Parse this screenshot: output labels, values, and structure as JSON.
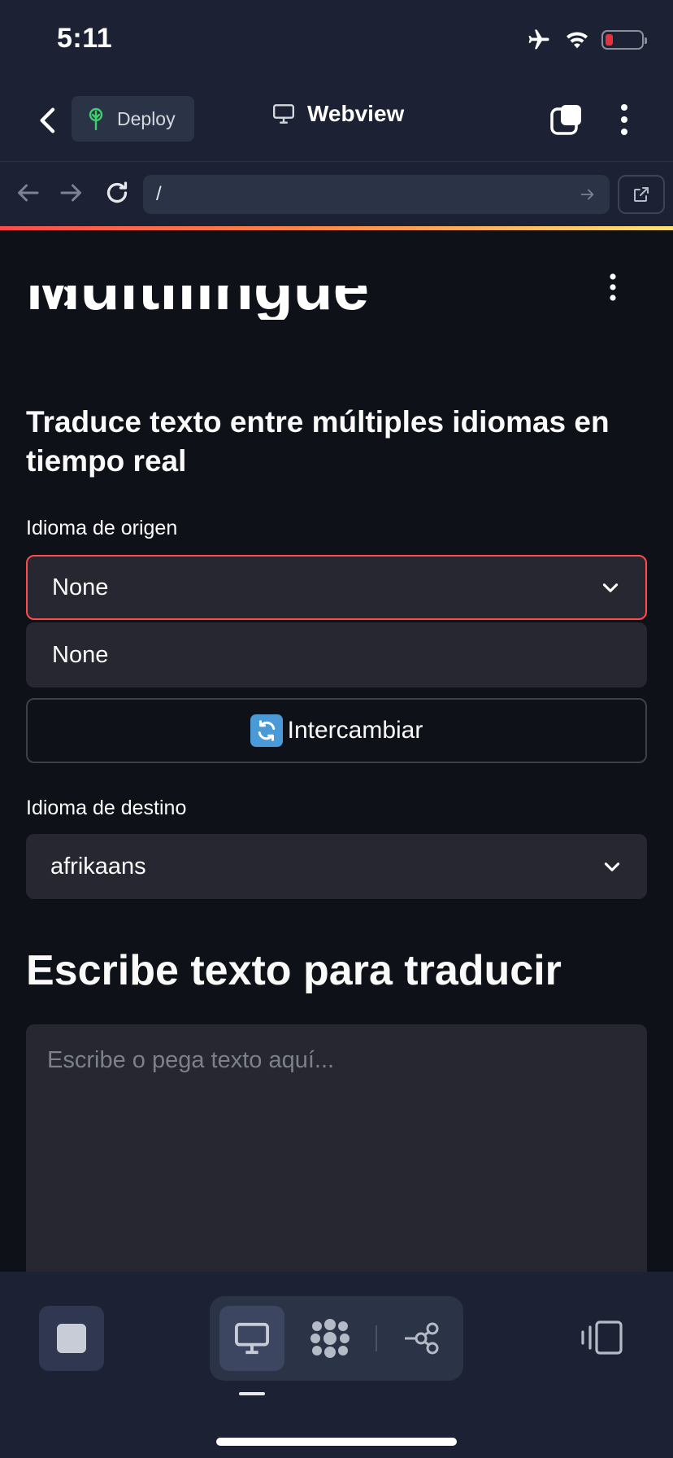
{
  "status_bar": {
    "time": "5:11"
  },
  "header": {
    "deploy_label": "Deploy",
    "title": "Webview"
  },
  "browser": {
    "url": "/"
  },
  "page": {
    "title_fragment": "Multilingüe",
    "subtitle": "Traduce texto entre múltiples idiomas en tiempo real",
    "source_label": "Idioma de origen",
    "source_value": "None",
    "dropdown_options": [
      "None"
    ],
    "swap_label": "Intercambiar",
    "target_label": "Idioma de destino",
    "target_value": "afrikaans",
    "input_heading": "Escribe texto para traducir",
    "input_placeholder": "Escribe o pega texto aquí..."
  },
  "colors": {
    "accent": "#ff4b4b",
    "background": "#0e1117",
    "chrome": "#1c2233",
    "widget": "#262730"
  }
}
